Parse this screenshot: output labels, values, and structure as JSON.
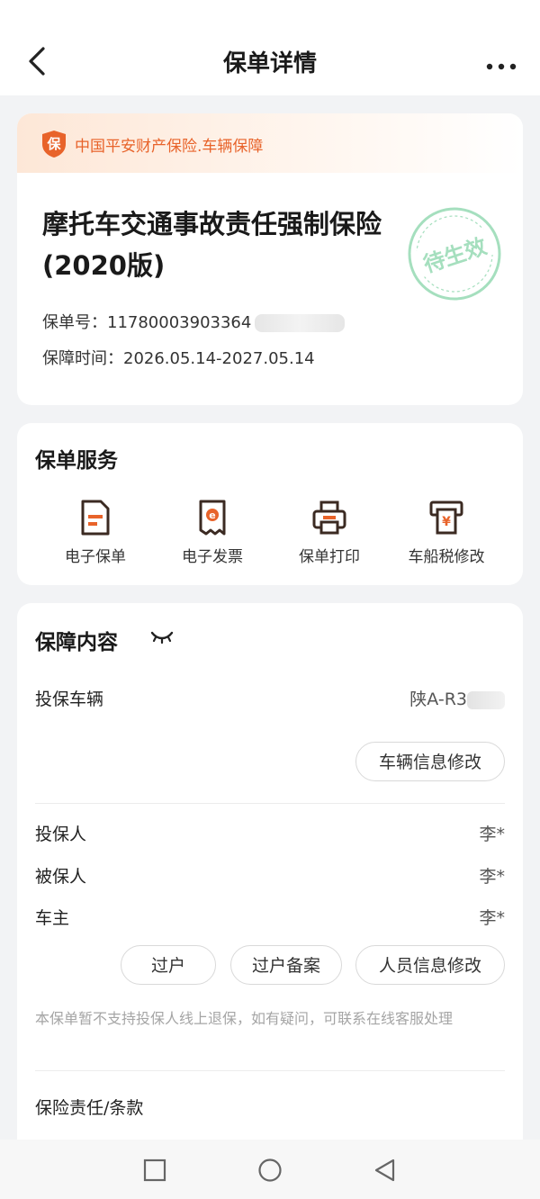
{
  "header": {
    "title": "保单详情"
  },
  "policy_card": {
    "insurer": "中国平安财产保险.车辆保障",
    "shield_char": "保",
    "policy_name": "摩托车交通事故责任强制保险(2020版)",
    "stamp_text": "待生效",
    "policy_no_label": "保单号：",
    "policy_no_value": "11780003903364",
    "period_label": "保障时间：",
    "period_value": "2026.05.14-2027.05.14"
  },
  "services": {
    "title": "保单服务",
    "items": [
      {
        "label": "电子保单",
        "icon": "document-icon"
      },
      {
        "label": "电子发票",
        "icon": "invoice-icon"
      },
      {
        "label": "保单打印",
        "icon": "printer-icon"
      },
      {
        "label": "车船税修改",
        "icon": "tax-icon"
      }
    ]
  },
  "coverage": {
    "title": "保障内容",
    "vehicle_label": "投保车辆",
    "vehicle_value": "陕A-R3",
    "vehicle_edit_button": "车辆信息修改",
    "policyholder_label": "投保人",
    "policyholder_value": "李*",
    "insured_label": "被保人",
    "insured_value": "李*",
    "owner_label": "车主",
    "owner_value": "李*",
    "transfer_button": "过户",
    "transfer_record_button": "过户备案",
    "person_edit_button": "人员信息修改",
    "notice": "本保单暂不支持投保人线上退保，如有疑问，可联系在线客服处理",
    "terms_label": "保险责任/条款"
  },
  "colors": {
    "accent": "#e8632a",
    "stamp": "#5cc58a"
  }
}
